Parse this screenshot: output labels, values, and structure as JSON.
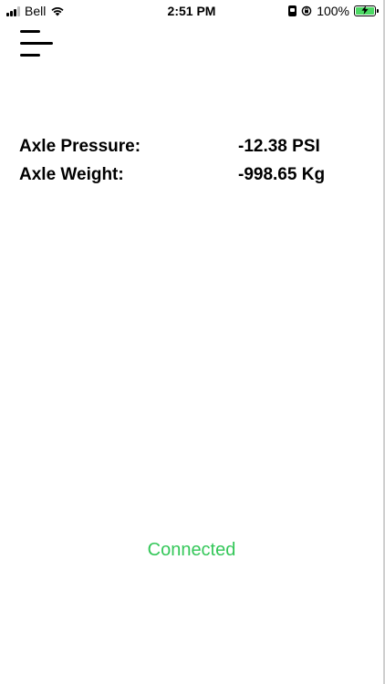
{
  "status_bar": {
    "carrier": "Bell",
    "time": "2:51 PM",
    "battery_percent": "100%",
    "battery_color": "#4cd964"
  },
  "menu": {
    "icon": "hamburger-menu-icon"
  },
  "readings": [
    {
      "label": "Axle Pressure:",
      "value": "-12.38 PSI"
    },
    {
      "label": "Axle Weight:",
      "value": "-998.65 Kg"
    }
  ],
  "connection": {
    "status": "Connected",
    "color": "#34c759"
  }
}
